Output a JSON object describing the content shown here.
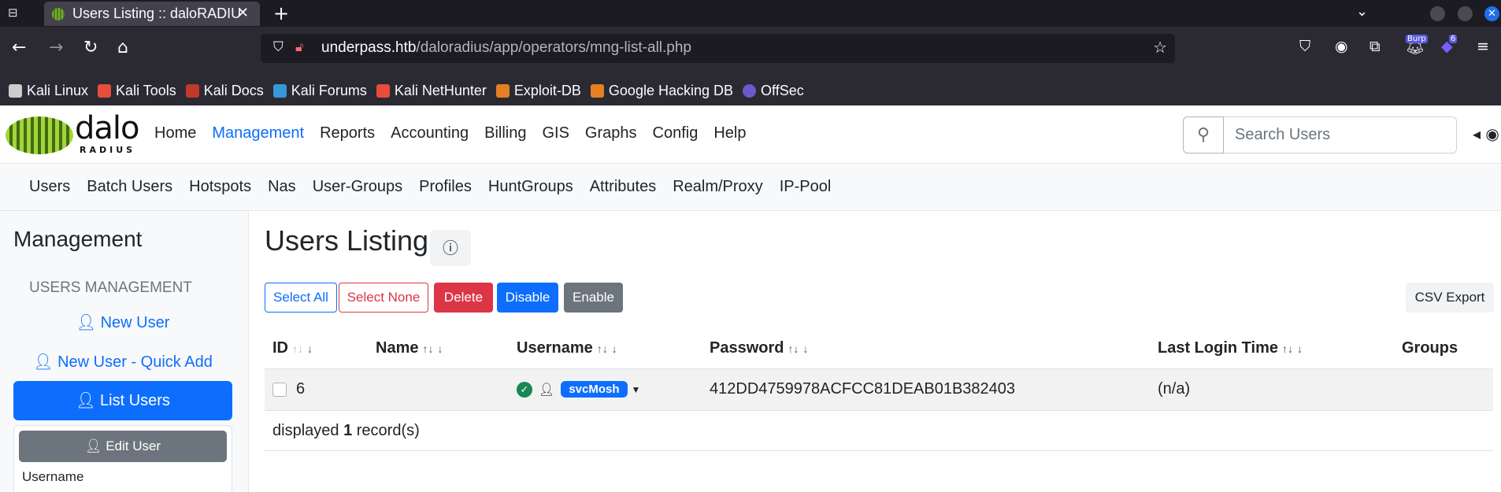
{
  "browser": {
    "tab_title": "Users Listing :: daloRADIUS",
    "url_host": "underpass.htb",
    "url_path": "/daloradius/app/operators/mng-list-all.php",
    "ext_badge_burp": "Burp",
    "ext_badge_count": "6",
    "bookmarks": [
      "Kali Linux",
      "Kali Tools",
      "Kali Docs",
      "Kali Forums",
      "Kali NetHunter",
      "Exploit-DB",
      "Google Hacking DB",
      "OffSec"
    ]
  },
  "header": {
    "logo_text": "dalo",
    "logo_sub": "RADIUS",
    "nav": [
      "Home",
      "Management",
      "Reports",
      "Accounting",
      "Billing",
      "GIS",
      "Graphs",
      "Config",
      "Help"
    ],
    "active_nav": "Management",
    "search_placeholder": "Search Users"
  },
  "subnav": [
    "Users",
    "Batch Users",
    "Hotspots",
    "Nas",
    "User-Groups",
    "Profiles",
    "HuntGroups",
    "Attributes",
    "Realm/Proxy",
    "IP-Pool"
  ],
  "sidebar": {
    "title": "Management",
    "section": "USERS MANAGEMENT",
    "new_user": "New User",
    "quick_add": "New User - Quick Add",
    "list_users": "List Users",
    "edit_user": "Edit User",
    "username_label": "Username"
  },
  "main": {
    "title": "Users Listing",
    "buttons": {
      "select_all": "Select All",
      "select_none": "Select None",
      "delete": "Delete",
      "disable": "Disable",
      "enable": "Enable",
      "csv_export": "CSV Export"
    },
    "columns": [
      "ID",
      "Name",
      "Username",
      "Password",
      "Last Login Time",
      "Groups"
    ],
    "rows": [
      {
        "id": "6",
        "name": "",
        "username": "svcMosh",
        "password": "412DD4759978ACFCC81DEAB01B382403",
        "last_login": "(n/a)",
        "groups": ""
      }
    ],
    "footer_prefix": "displayed",
    "footer_count": "1",
    "footer_suffix": "record(s)"
  },
  "colors": {
    "primary": "#0d6efd",
    "danger": "#dc3545",
    "secondary": "#6c757d",
    "success": "#198754"
  }
}
